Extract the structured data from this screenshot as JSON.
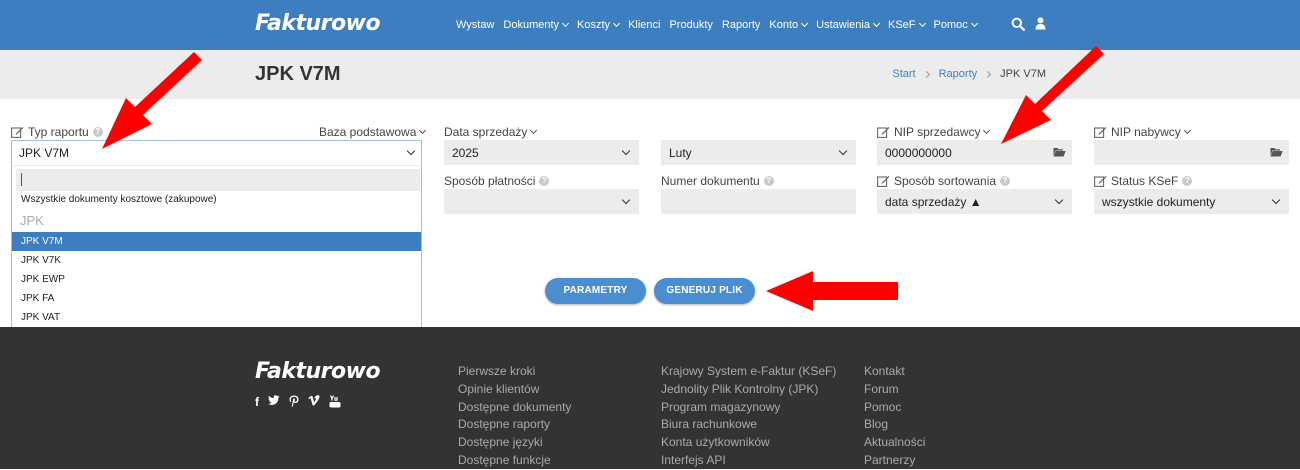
{
  "header": {
    "logo": "Fakturowo",
    "nav": [
      {
        "label": "Wystaw",
        "dropdown": false
      },
      {
        "label": "Dokumenty",
        "dropdown": true
      },
      {
        "label": "Koszty",
        "dropdown": true
      },
      {
        "label": "Klienci",
        "dropdown": false
      },
      {
        "label": "Produkty",
        "dropdown": false
      },
      {
        "label": "Raporty",
        "dropdown": false
      },
      {
        "label": "Konto",
        "dropdown": true
      },
      {
        "label": "Ustawienia",
        "dropdown": true
      },
      {
        "label": "KSeF",
        "dropdown": true
      },
      {
        "label": "Pomoc",
        "dropdown": true
      }
    ]
  },
  "page": {
    "title": "JPK V7M",
    "breadcrumb": [
      "Start",
      "Raporty",
      "JPK V7M"
    ]
  },
  "form": {
    "typ_raportu": {
      "label": "Typ raportu",
      "value": "JPK V7M"
    },
    "baza": {
      "label": "Baza podstawowa"
    },
    "data_sprzedazy": {
      "label": "Data sprzedaży",
      "year": "2025",
      "month": "Luty"
    },
    "nip_sprzedawcy": {
      "label": "NIP sprzedawcy",
      "value": "0000000000"
    },
    "nip_nabywcy": {
      "label": "NIP nabywcy",
      "value": ""
    },
    "sposob_platnosci": {
      "label": "Sposób płatności",
      "value": ""
    },
    "numer_dokumentu": {
      "label": "Numer dokumentu",
      "value": ""
    },
    "sposob_sortowania": {
      "label": "Sposób sortowania",
      "value": "data sprzedaży ▲"
    },
    "status_ksef": {
      "label": "Status KSeF",
      "value": "wszystkie dokumenty"
    }
  },
  "dropdown": {
    "first_option": "Wszystkie dokumenty kosztowe (zakupowe)",
    "group_label": "JPK",
    "options": [
      "JPK V7M",
      "JPK V7K",
      "JPK EWP",
      "JPK FA",
      "JPK VAT"
    ],
    "selected": "JPK V7M"
  },
  "buttons": {
    "parametry": "PARAMETRY",
    "generuj": "GENERUJ PLIK"
  },
  "footer": {
    "logo": "Fakturowo",
    "social_icons": [
      "facebook-icon",
      "twitter-icon",
      "pinterest-icon",
      "vimeo-icon",
      "youtube-icon"
    ],
    "col1": [
      "Pierwsze kroki",
      "Opinie klientów",
      "Dostępne dokumenty",
      "Dostępne raporty",
      "Dostępne języki",
      "Dostępne funkcje"
    ],
    "col2": [
      "Krajowy System e-Faktur (KSeF)",
      "Jednolity Plik Kontrolny (JPK)",
      "Program magazynowy",
      "Biura rachunkowe",
      "Konta użytkowników",
      "Interfejs API"
    ],
    "col3": [
      "Kontakt",
      "Forum",
      "Pomoc",
      "Blog",
      "Aktualności",
      "Partnerzy"
    ]
  },
  "annotation_color": "#ff0000",
  "accent_color": "#3d7ec0"
}
